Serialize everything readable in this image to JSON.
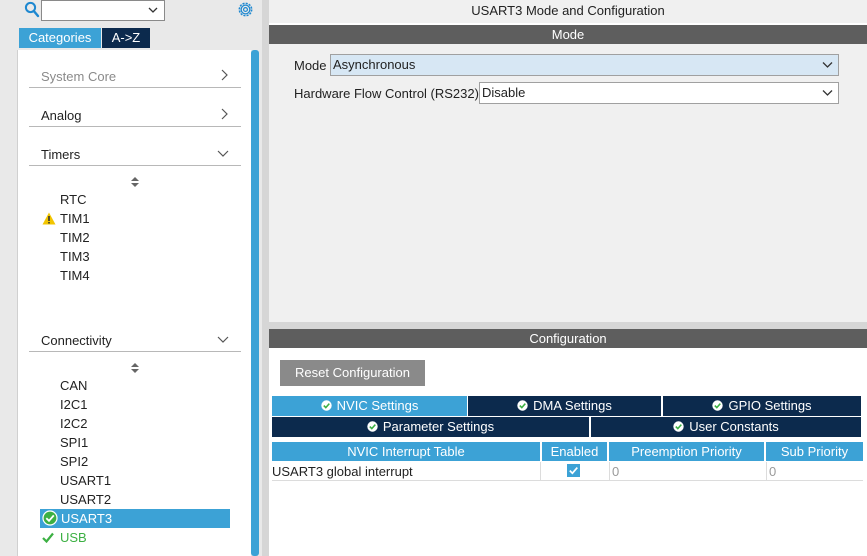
{
  "left": {
    "tabs": [
      "Categories",
      "A->Z"
    ],
    "categories": [
      {
        "label": "System Core",
        "muted": true
      },
      {
        "label": "Analog"
      },
      {
        "label": "Timers",
        "items": [
          "RTC",
          "TIM1",
          "TIM2",
          "TIM3",
          "TIM4"
        ],
        "warning_item": "TIM1"
      },
      {
        "label": "Connectivity",
        "items": [
          "CAN",
          "I2C1",
          "I2C2",
          "SPI1",
          "SPI2",
          "USART1",
          "USART2",
          "USART3",
          "USB"
        ],
        "selected_item": "USART3",
        "ok_items": [
          "USART3",
          "USB"
        ]
      }
    ]
  },
  "right": {
    "title": "USART3 Mode and Configuration",
    "mode_header": "Mode",
    "mode_label": "Mode",
    "mode_value": "Asynchronous",
    "flow_label": "Hardware Flow Control (RS232)",
    "flow_value": "Disable",
    "config_header": "Configuration",
    "reset_label": "Reset Configuration",
    "tabs_row1": [
      "NVIC Settings",
      "DMA Settings",
      "GPIO Settings"
    ],
    "tabs_row2": [
      "Parameter Settings",
      "User Constants"
    ],
    "active_tab": "NVIC Settings",
    "table": {
      "headers": [
        "NVIC Interrupt Table",
        "Enabled",
        "Preemption Priority",
        "Sub Priority"
      ],
      "rows": [
        {
          "name": "USART3 global interrupt",
          "enabled": true,
          "preemption": "0",
          "sub": "0"
        }
      ]
    }
  },
  "colors": {
    "accent": "#3ca2d6",
    "dark_tab": "#0c2a4d",
    "header_bar": "#5e5e5e",
    "ok_green": "#3cb043",
    "warning": "#f2c500"
  }
}
